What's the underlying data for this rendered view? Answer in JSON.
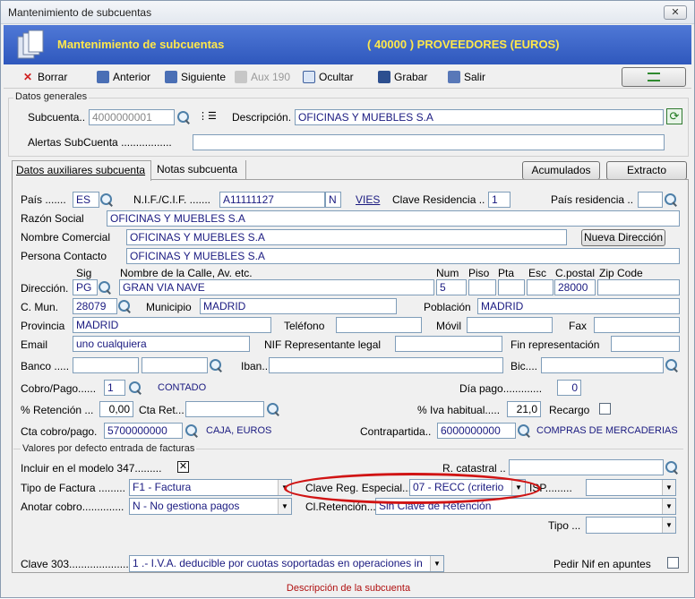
{
  "window": {
    "title": "Mantenimiento de subcuentas",
    "close_label": "✕"
  },
  "banner": {
    "title": "Mantenimiento de subcuentas",
    "account": "( 40000 ) PROVEEDORES (EUROS)"
  },
  "toolbar": {
    "borrar": "Borrar",
    "anterior": "Anterior",
    "siguiente": "Siguiente",
    "aux190": "Aux 190",
    "ocultar": "Ocultar",
    "grabar": "Grabar",
    "salir": "Salir"
  },
  "general": {
    "group_label": "Datos generales",
    "subcuenta_label": "Subcuenta..",
    "subcuenta_value": "4000000001",
    "descripcion_label": "Descripción.",
    "descripcion_value": "OFICINAS Y MUEBLES S.A",
    "alertas_label": "Alertas SubCuenta .................",
    "alertas_value": ""
  },
  "tabs": [
    {
      "label": "Datos auxiliares subcuenta"
    },
    {
      "label": "Notas subcuenta"
    }
  ],
  "buttons": {
    "acumulados": "Acumulados",
    "extracto": "Extracto",
    "nueva_direccion": "Nueva Dirección"
  },
  "form": {
    "pais_label": "País .......",
    "pais_value": "ES",
    "nif_label": "N.I.F./C.I.F. .......",
    "nif_value": "A11111127",
    "nif_type": "N",
    "vies": "VIES",
    "clave_res_label": "Clave Residencia ..",
    "clave_res_value": "1",
    "pais_res_label": "País residencia ..",
    "pais_res_value": "",
    "razon_label": "Razón Social",
    "razon_value": "OFICINAS Y MUEBLES S.A",
    "nombre_com_label": "Nombre Comercial",
    "nombre_com_value": "OFICINAS Y MUEBLES S.A",
    "persona_label": "Persona Contacto",
    "persona_value": "OFICINAS Y MUEBLES S.A",
    "sig_label": "Sig",
    "calle_label": "Nombre de la Calle, Av. etc.",
    "num_label": "Num",
    "piso_label": "Piso",
    "pta_label": "Pta",
    "esc_label": "Esc",
    "cp_label": "C.postal",
    "zip_label": "Zip Code",
    "direccion_label": "Dirección.",
    "sig_value": "PG",
    "calle_value": "GRAN VIA NAVE",
    "num_value": "5",
    "piso_value": "",
    "pta_value": "",
    "esc_value": "",
    "cp_value": "28000",
    "zip_value": "",
    "cmun_label": "C. Mun.",
    "cmun_value": "28079",
    "municipio_label": "Municipio",
    "municipio_value": "MADRID",
    "poblacion_label": "Población",
    "poblacion_value": "MADRID",
    "provincia_label": "Provincia",
    "provincia_value": "MADRID",
    "telefono_label": "Teléfono",
    "movil_label": "Móvil",
    "fax_label": "Fax",
    "email_label": "Email",
    "email_value": "uno cualquiera",
    "nif_rep_label": "NIF Representante legal",
    "fin_rep_label": "Fin representación",
    "banco_label": "Banco .....",
    "iban_label": "Iban..",
    "bic_label": "Bic....",
    "cobro_label": "Cobro/Pago......",
    "cobro_value": "1",
    "cobro_desc": "CONTADO",
    "dia_pago_label": "Día pago.............",
    "dia_pago_value": "0",
    "retencion_label": "% Retención ...",
    "retencion_value": "0,00",
    "cta_ret_label": "Cta Ret...",
    "iva_label": "% Iva habitual.....",
    "iva_value": "21,0",
    "recargo_label": "Recargo",
    "cta_cobro_label": "Cta cobro/pago.",
    "cta_cobro_value": "5700000000",
    "cta_cobro_desc": "CAJA, EUROS",
    "contrapartida_label": "Contrapartida..",
    "contrapartida_value": "6000000000",
    "contrapartida_desc": "COMPRAS DE MERCADERIAS",
    "valores_label": "Valores por defecto entrada de facturas",
    "incluir_label": "Incluir en el modelo 347.........",
    "incluir_mark": "✕",
    "ref_cat_label": "R. catastral ..",
    "tipo_factura_label": "Tipo de Factura .........",
    "tipo_factura_value": "F1 - Factura",
    "clave_reg_label": "Clave Reg. Especial....",
    "clave_reg_value": "07 - RECC (criterio",
    "isp_label": "ISP.........",
    "anotar_label": "Anotar cobro..............",
    "anotar_value": "N - No gestiona pagos",
    "cl_ret_label": "Cl.Retención...",
    "cl_ret_value": "Sin Clave de Retención",
    "tipo_label": "Tipo ...",
    "clave303_label": "Clave 303.....................",
    "clave303_value": "1 .- I.V.A. deducible por cuotas soportadas en operaciones in",
    "pedir_nif_label": "Pedir Nif en apuntes"
  },
  "status": "Descripción de la subcuenta"
}
